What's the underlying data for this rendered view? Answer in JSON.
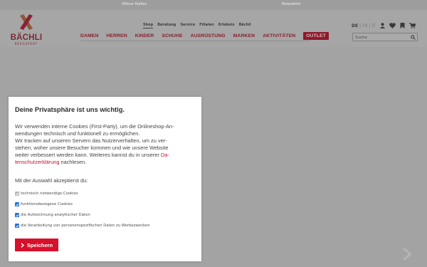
{
  "topbar": {
    "jobs": "Offene Stellen",
    "newsletter": "Newsletter"
  },
  "logo": {
    "brand": "BÄCHLI",
    "sub": "BERGSPORT"
  },
  "subnav": [
    "Shop",
    "Beratung",
    "Service",
    "Filialen",
    "Erlebnis",
    "Bächli"
  ],
  "mainnav": [
    "DAMEN",
    "HERREN",
    "KINDER",
    "SCHUHE",
    "AUSRÜSTUNG",
    "MARKEN",
    "AKTIVITÄTEN",
    "OUTLET"
  ],
  "lang": {
    "de": "DE",
    "fr": "FR",
    "it": "IT"
  },
  "search": {
    "placeholder": "Suche"
  },
  "dialog": {
    "title": "Deine Privatsphäre ist uns wichtig.",
    "lines": [
      "Wir verwenden interne Cookies (First-Party), um die Onlineshop-An-",
      "wendungen technisch und funktionell zu ermöglichen.",
      "Wir tracken auf unseren Servern das Nutzerverhalten, um zu ver-",
      "stehen, woher unsere Besucher kommen und wie unsere Website",
      "weiter verbessert werden kann. Weiteres kannst du in unserer "
    ],
    "link_part1": "Da-",
    "link_part2": "tenschutzerklärung",
    "after_link": " nachlesen.",
    "choose": "Mit der Auswahl akzeptierst du:",
    "options": [
      {
        "label": "technisch notwendige Cookies",
        "checked": true,
        "disabled": true
      },
      {
        "label": "funktionsbezogene Cookies",
        "checked": true,
        "disabled": false
      },
      {
        "label": "die Aufzeichnung analytischer Daten",
        "checked": true,
        "disabled": false
      },
      {
        "label": "die Verarbeitung von personenspezifischen Daten zu Werbezwecken",
        "checked": true,
        "disabled": false
      }
    ],
    "save_label": "Speichern"
  },
  "colors": {
    "brand_red": "#c8102e",
    "checkbox_blue": "#2574d8"
  }
}
